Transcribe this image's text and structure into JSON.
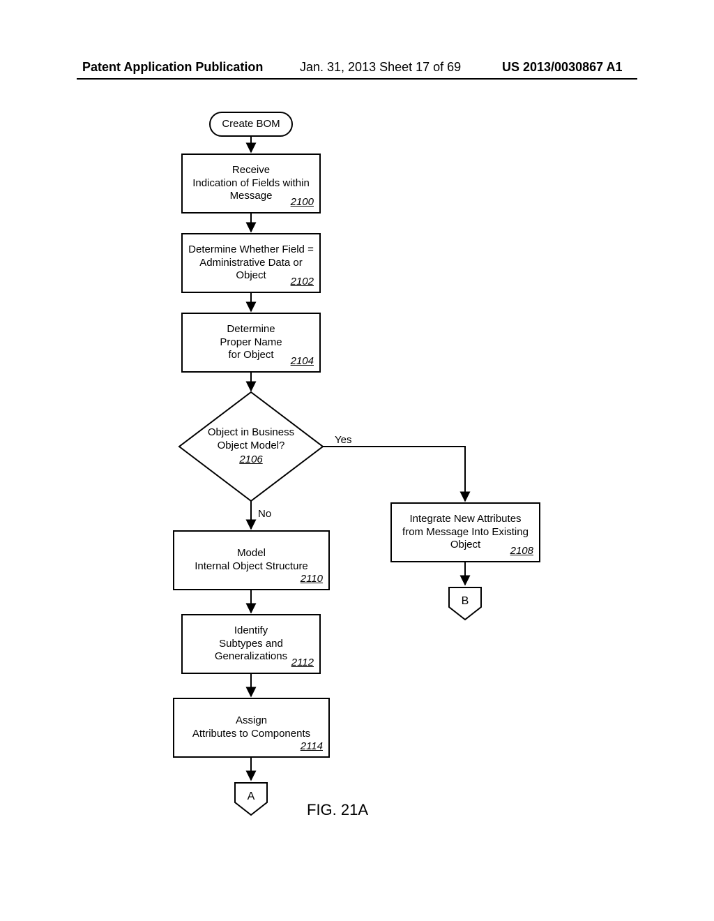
{
  "header": {
    "left": "Patent Application Publication",
    "mid": "Jan. 31, 2013  Sheet 17 of 69",
    "right": "US 2013/0030867 A1"
  },
  "start": "Create BOM",
  "steps": {
    "s2100": {
      "l1": "Receive",
      "l2": "Indication of Fields within",
      "l3": "Message",
      "ref": "2100"
    },
    "s2102": {
      "l1": "Determine Whether Field =",
      "l2": "Administrative Data or",
      "l3": "Object",
      "ref": "2102"
    },
    "s2104": {
      "l1": "Determine",
      "l2": "Proper Name",
      "l3": "for Object",
      "ref": "2104"
    },
    "d2106": {
      "l1": "Object in Business",
      "l2": "Object Model?",
      "ref": "2106"
    },
    "s2108": {
      "l1": "Integrate New Attributes",
      "l2": "from Message Into Existing",
      "l3": "Object",
      "ref": "2108"
    },
    "s2110": {
      "l1": "Model",
      "l2": "Internal Object Structure",
      "ref": "2110"
    },
    "s2112": {
      "l1": "Identify",
      "l2": "Subtypes and",
      "l3": "Generalizations",
      "ref": "2112"
    },
    "s2114": {
      "l1": "Assign",
      "l2": "Attributes to Components",
      "ref": "2114"
    }
  },
  "labels": {
    "yes": "Yes",
    "no": "No"
  },
  "connectors": {
    "a": "A",
    "b": "B"
  },
  "figure": "FIG. 21A"
}
